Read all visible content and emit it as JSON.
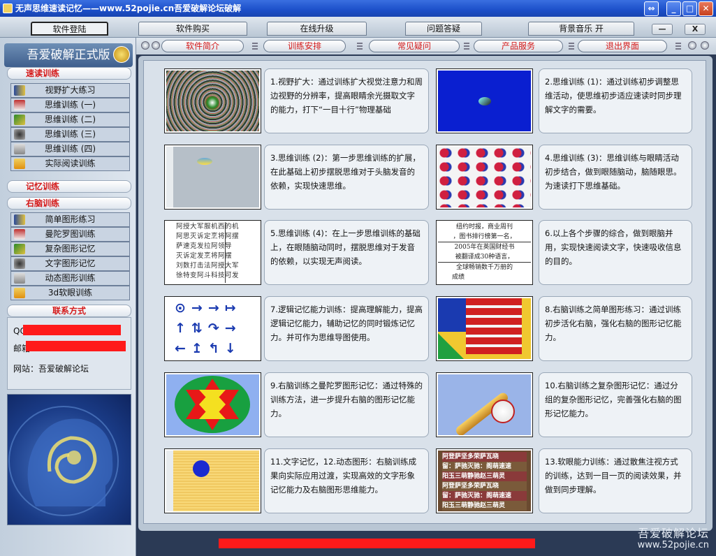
{
  "window": {
    "title": "无声思维速读记忆——www.52pojie.cn吾爱破解论坛破解",
    "buttons": {
      "restore": "⇔",
      "minimize": "_",
      "maximize": "□",
      "close": "✕"
    }
  },
  "top_menu": [
    {
      "label": "软件登陆",
      "active": true
    },
    {
      "label": "软件购买"
    },
    {
      "label": "在线升级"
    },
    {
      "label": "问题答疑"
    },
    {
      "label": "背景音乐 开"
    }
  ],
  "top_mini": {
    "minimize": "—",
    "close": "X"
  },
  "sub_tabs": [
    "软件简介",
    "训练安排",
    "常见疑问",
    "产品服务",
    "退出界面"
  ],
  "sidebar": {
    "brand": "吾爱破解正式版",
    "speed_title": "速读训练",
    "speed_items": [
      "视野扩大练习",
      "思维训练 (一)",
      "思维训练 (二)",
      "思维训练 (三)",
      "思维训练 (四)",
      "实际阅读训练"
    ],
    "memory_title": "记忆训练",
    "right_title": "右脑训练",
    "right_items": [
      "简单图形练习",
      "曼陀罗图训练",
      "复杂图形记忆",
      "文字图形记忆",
      "动态图形训练",
      "3d软眼训练"
    ],
    "contact_title": "联系方式",
    "contact": {
      "qq_label": "QQ",
      "mail_label": "邮箱",
      "site": "网站：吾爱破解论坛"
    }
  },
  "cards": [
    {
      "text": "1.视野扩大：通过训练扩大视觉注意力和周边视野的分辨率，提高眼睛余光摄取文字的能力，打下“一目十行”物理基础",
      "thumb": "spiral"
    },
    {
      "text": "2.思维训练 (1)：通过训练初步调整思维活动，使思维初步适应速读时同步理解文字的需要。",
      "thumb": "blue-ball"
    },
    {
      "text": "3.思维训练 (2)：第一步思维训练的扩展，在此基础上初步摆脱思维对于头脑发音的依赖，实现快速思维。",
      "thumb": "gray-bird"
    },
    {
      "text": "4.思维训练 (3)：思维训练与眼睛活动初步结合，做到眼随脑动，脑随眼思。为速读打下思维基础。",
      "thumb": "dots"
    },
    {
      "text": "5.思维训练 (4)：在上一步思维训练的基础上，在眼随脑动同时，摆脱思维对于发音的依赖，以实现无声阅读。",
      "thumb": "text-grid"
    },
    {
      "text": "6.以上各个步骤的综合，做到眼脑并用，实现快速阅读文字，快速吸收信息的目的。",
      "thumb": "newspaper"
    },
    {
      "text": "7.逻辑记忆能力训练：提高理解能力，提高逻辑记忆能力，辅助记忆的同时锻炼记忆力。并可作为思维导图使用。",
      "thumb": "arrows"
    },
    {
      "text": "8.右脑训练之简单图形练习：通过训练初步活化右脑，强化右脑的图形记忆能力。",
      "thumb": "color-shapes"
    },
    {
      "text": "9.右脑训练之曼陀罗图形记忆：通过特殊的训练方法，进一步提升右脑的图形记忆能力。",
      "thumb": "mandala"
    },
    {
      "text": "10.右脑训练之复杂图形记忆：通过分组的复杂图形记忆，完善强化右脑的图形记忆能力。",
      "thumb": "baseball"
    },
    {
      "text": "11.文字记忆，12.动态图形：右脑训练成果向实际应用过渡，实现高效的文字形象记忆能力及右脑图形思维能力。",
      "thumb": "yellow-dot"
    },
    {
      "text": "13.软眼能力训练：通过散焦注视方式的训练，达到一目一页的阅读效果，并做到同步理解。",
      "thumb": "red-text"
    }
  ],
  "newspaper_lines": [
    "纽约时报，商业周刊",
    "，图书排行榜第一名，",
    "2005年在英国财经书",
    "被翻译成30种语言，",
    "全球畅销数千万册的",
    "成绩"
  ],
  "text_grid_lines": [
    "阿授大军服机西的机",
    "阿思灭诉定烹将阿摆",
    "萨速克发拉阿领导",
    "灭诉定发烹将阿摆",
    "刘数打击法阿授大军",
    "徐特变阿斗科技可发"
  ],
  "red_text_lines": [
    "阿登萨坚多荣萨瓦晓",
    "留：萨驰灭驰：阁萌速速",
    "阳玉三萌静驰赵三萌灵",
    "阿登萨坚多荣萨瓦晓",
    "留：萨驰灭驰：阁萌速速",
    "阳玉三萌静驰赵三萌灵"
  ],
  "watermark": {
    "line1": "吾爱破解论坛",
    "line2": "www.52pojie.cn"
  }
}
